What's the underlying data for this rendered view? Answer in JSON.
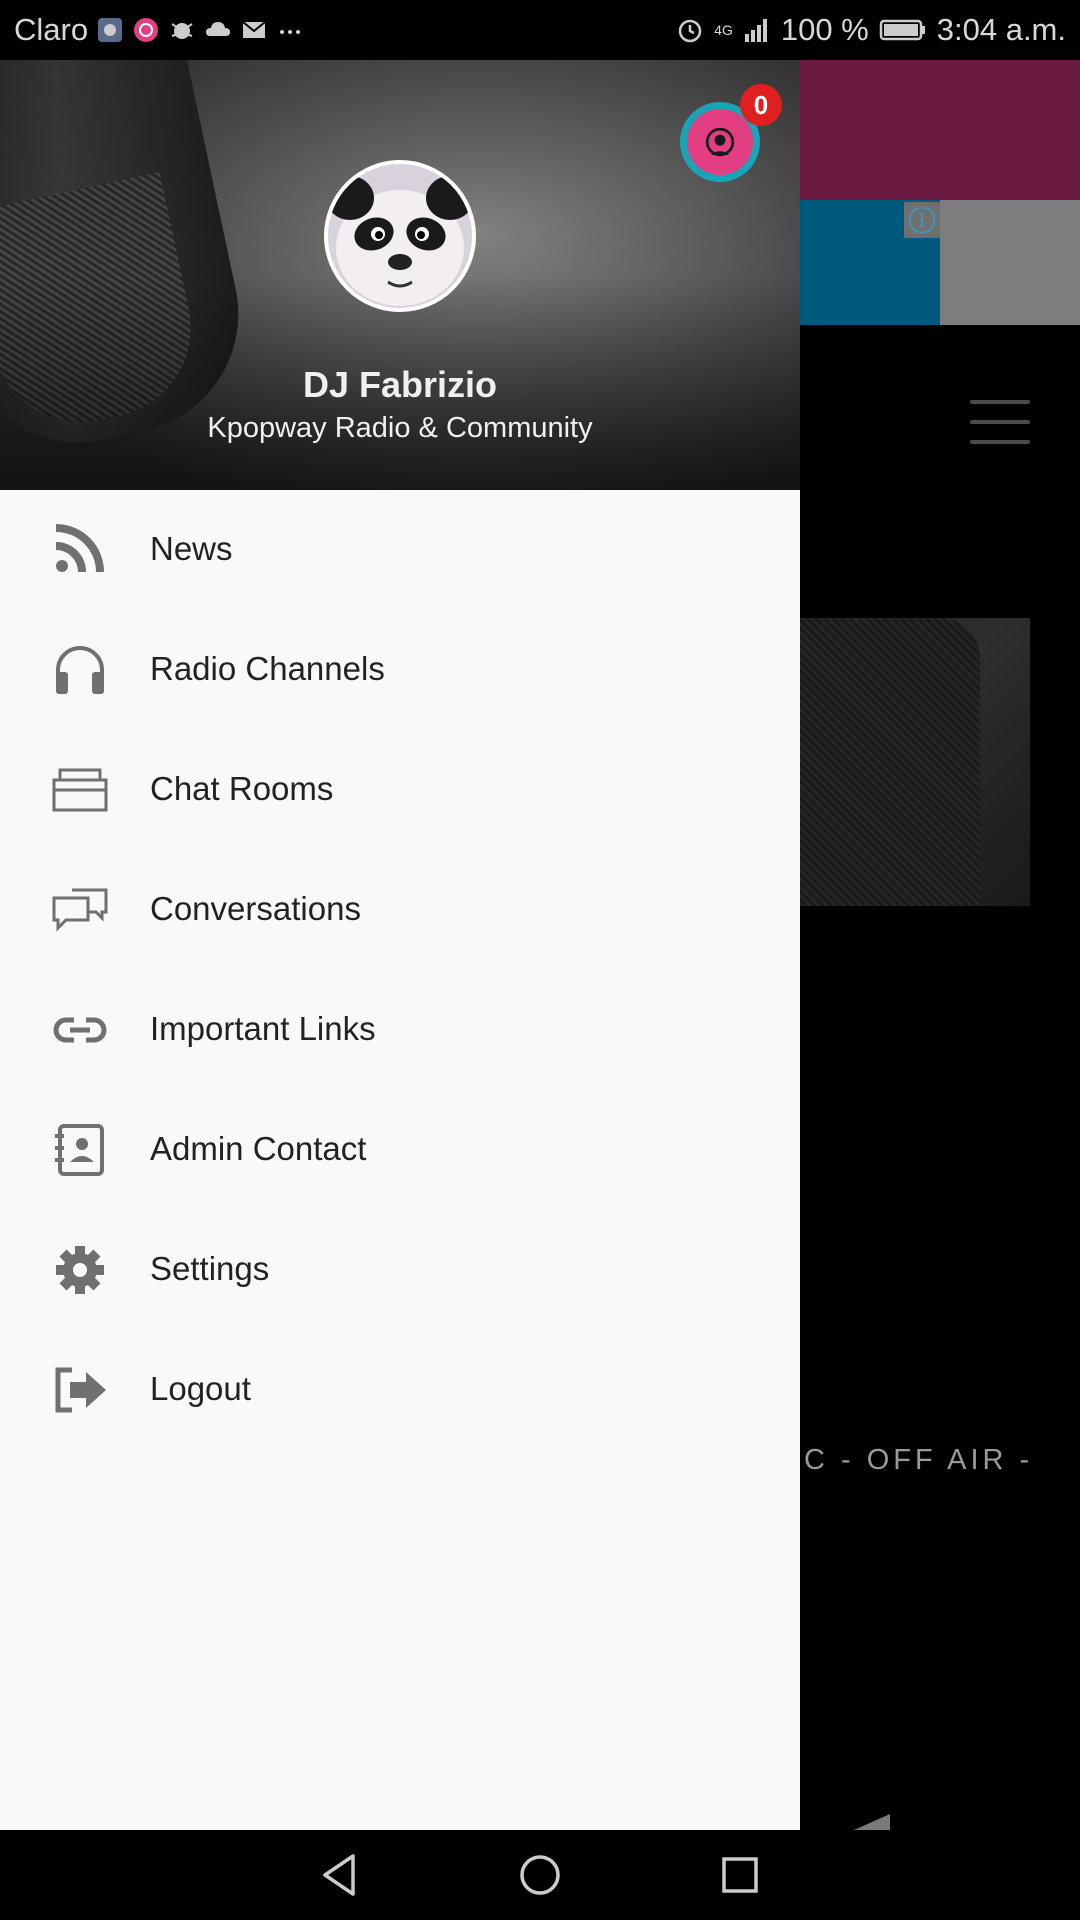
{
  "status_bar": {
    "carrier": "Claro",
    "battery": "100 %",
    "time": "3:04 a.m.",
    "network": "4G"
  },
  "drawer": {
    "profile_name": "DJ Fabrizio",
    "profile_subtitle": "Kpopway Radio & Community",
    "notification_count": "0",
    "menu": [
      {
        "label": "News",
        "icon": "rss-icon"
      },
      {
        "label": "Radio Channels",
        "icon": "headphones-icon"
      },
      {
        "label": "Chat Rooms",
        "icon": "chat-room-icon"
      },
      {
        "label": "Conversations",
        "icon": "conversations-icon"
      },
      {
        "label": "Important Links",
        "icon": "link-icon"
      },
      {
        "label": "Admin Contact",
        "icon": "contact-book-icon"
      },
      {
        "label": "Settings",
        "icon": "gear-icon"
      },
      {
        "label": "Logout",
        "icon": "logout-icon"
      }
    ]
  },
  "background_app": {
    "off_air_text": "C - OFF AIR -"
  },
  "colors": {
    "drawer_bg": "#f9f9f9",
    "badge_red": "#e02020",
    "radio_teal": "#1aa4b8",
    "radio_pink": "#e43e83",
    "ad_magenta": "#6b1a42",
    "ad_blue": "#005a7d"
  }
}
